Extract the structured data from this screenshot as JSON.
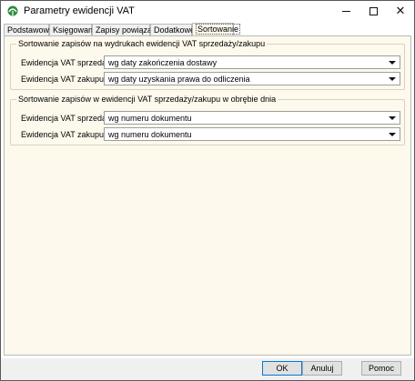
{
  "window": {
    "title": "Parametry ewidencji VAT",
    "controls": {
      "minimize": "─",
      "maximize": "☐",
      "close": "✕"
    }
  },
  "tabs": [
    {
      "label": "Podstawowe",
      "active": false
    },
    {
      "label": "Księgowanie",
      "active": false
    },
    {
      "label": "Zapisy powiązane",
      "active": false
    },
    {
      "label": "Dodatkowe",
      "active": false
    },
    {
      "label": "Sortowanie",
      "active": true
    }
  ],
  "groups": [
    {
      "title": "Sortowanie zapisów na wydrukach ewidencji VAT sprzedaży/zakupu",
      "rows": [
        {
          "label": "Ewidencja VAT sprzedaży:",
          "value": "wg daty zakończenia dostawy"
        },
        {
          "label": "Ewidencja VAT zakupu:",
          "value": "wg daty uzyskania prawa do odliczenia"
        }
      ]
    },
    {
      "title": "Sortowanie zapisów w ewidencji VAT sprzedaży/zakupu w obrębie dnia",
      "rows": [
        {
          "label": "Ewidencja VAT sprzedaży:",
          "value": "wg numeru dokumentu"
        },
        {
          "label": "Ewidencja VAT zakupu:",
          "value": "wg numeru dokumentu"
        }
      ]
    }
  ],
  "buttons": {
    "ok": "OK",
    "cancel": "Anuluj",
    "help": "Pomoc"
  },
  "colors": {
    "panel": "#fdf9ec",
    "accent": "#0078d7"
  }
}
